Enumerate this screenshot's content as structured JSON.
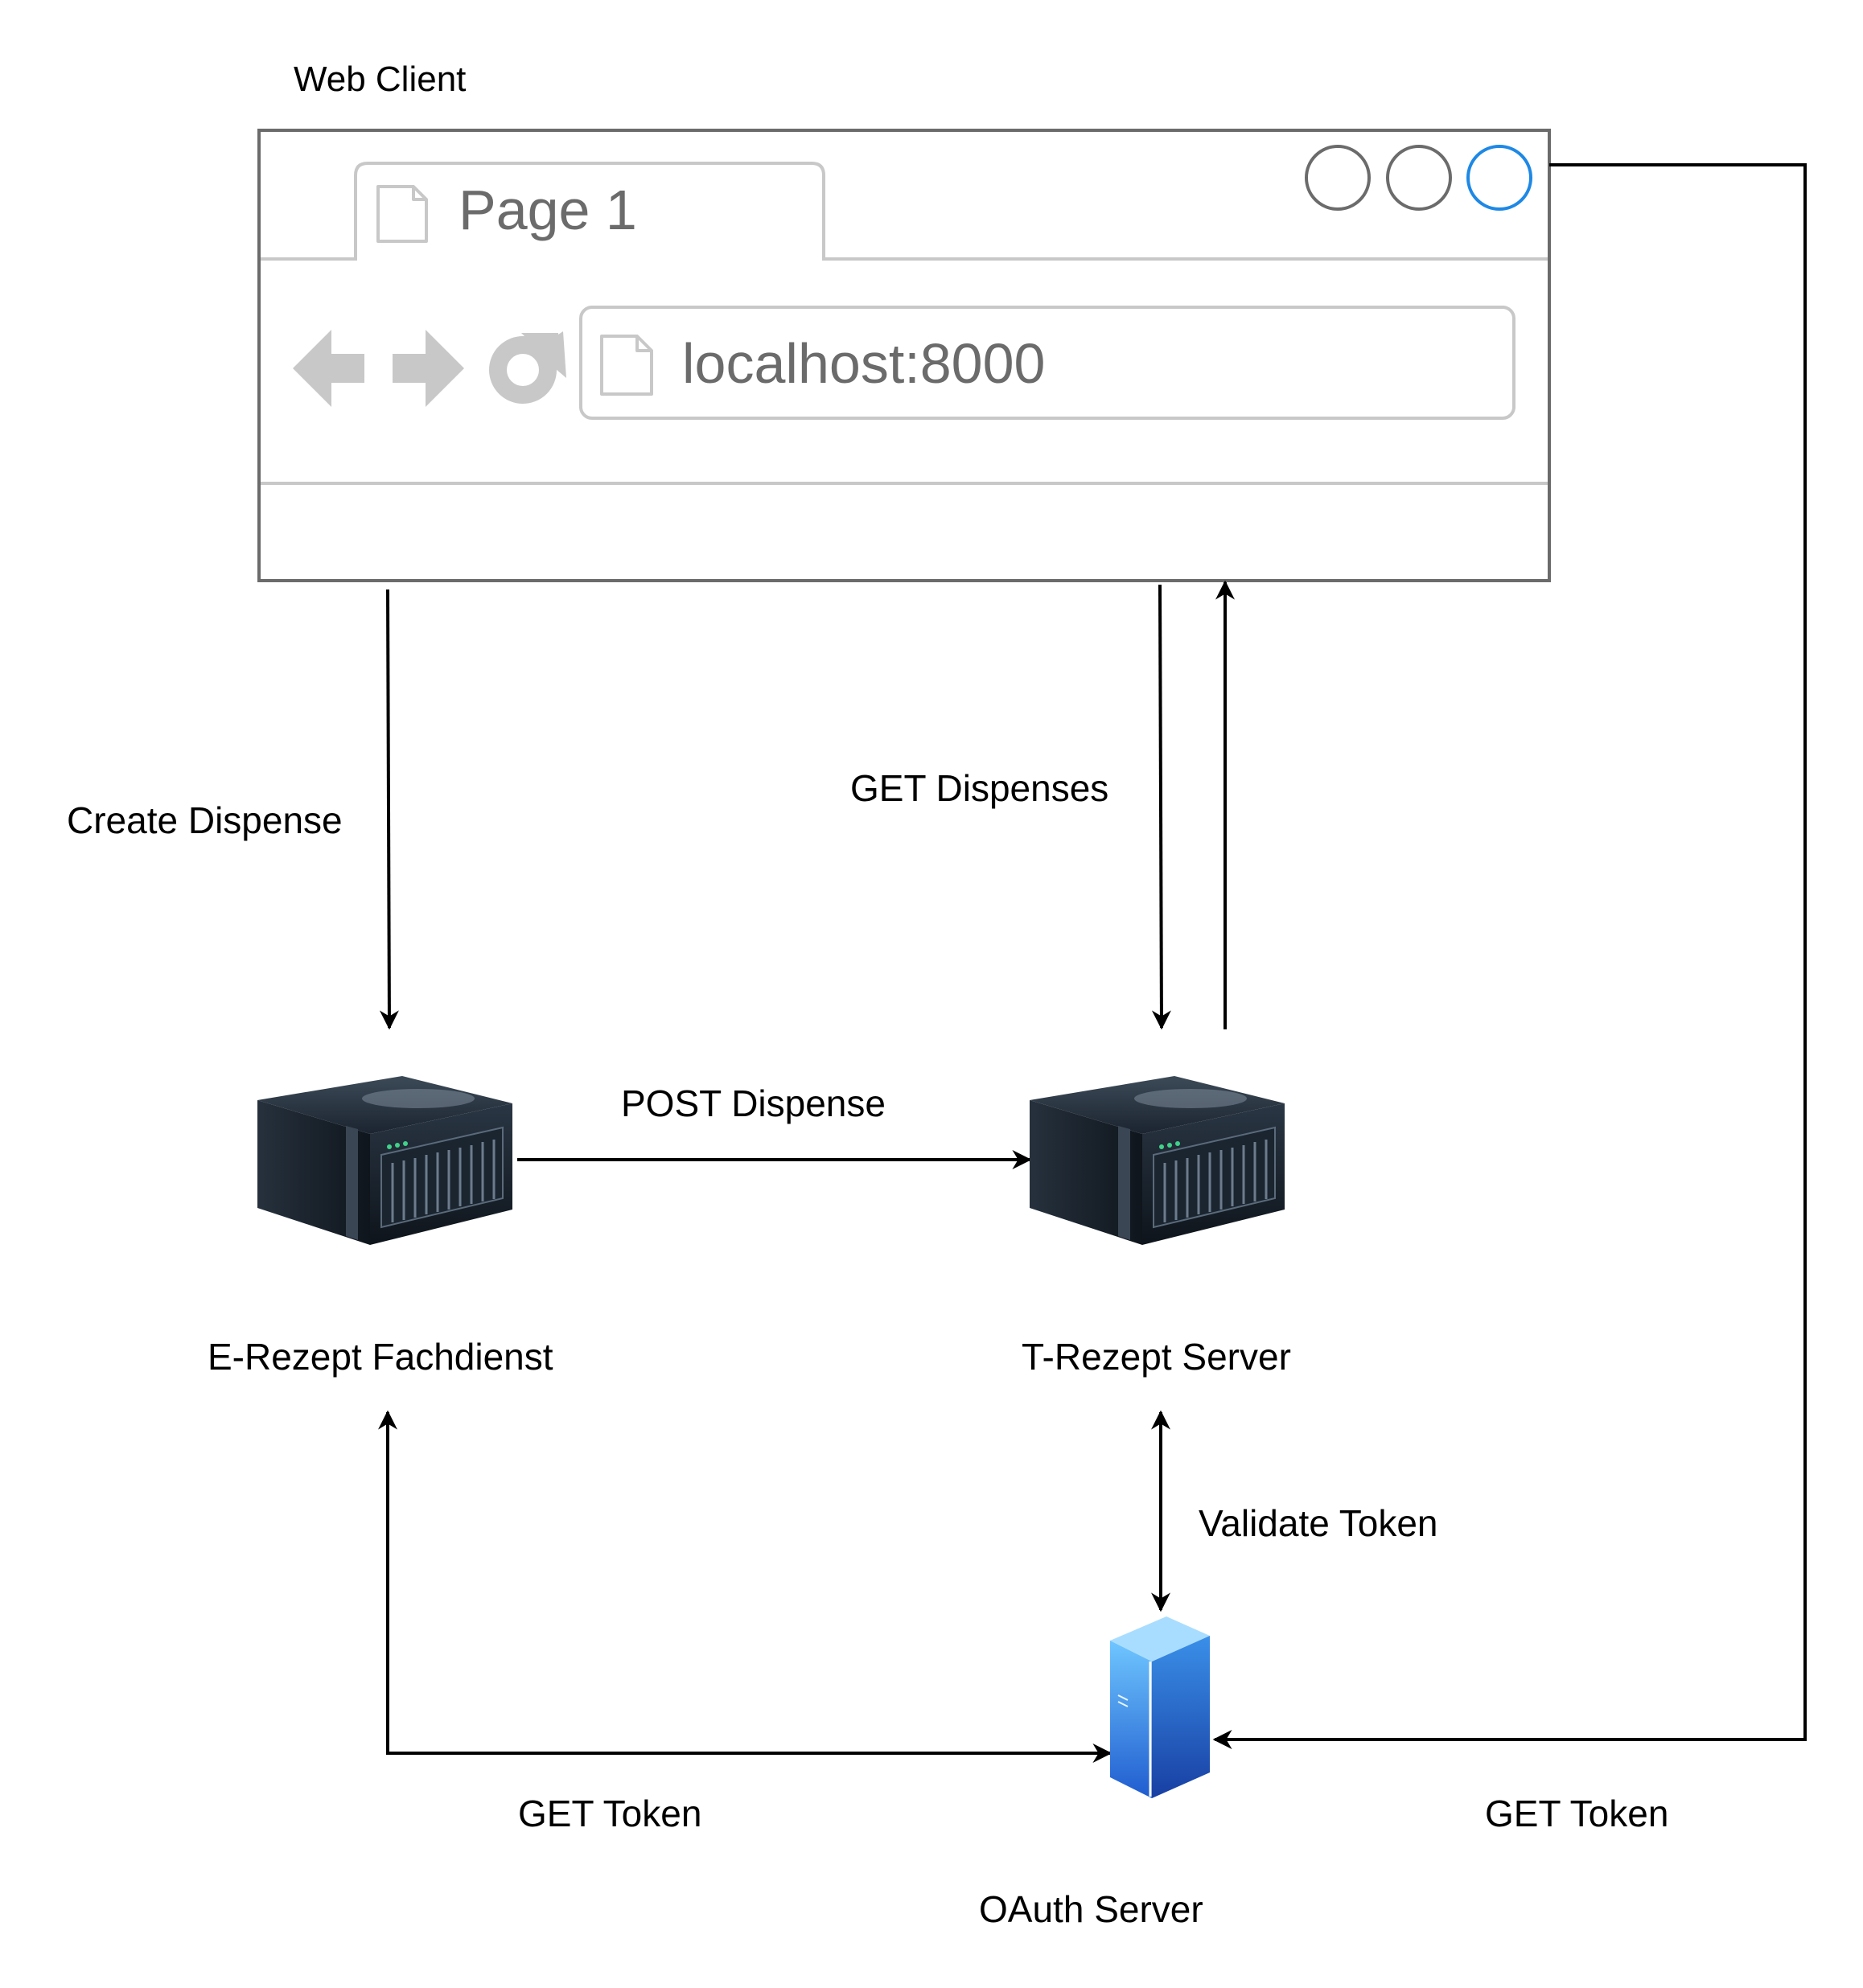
{
  "browser": {
    "window_label": "Web Client",
    "tab_label": "Page 1",
    "url": "localhost:8000"
  },
  "nodes": {
    "e_rezept": "E-Rezept Fachdienst",
    "t_rezept": "T-Rezept Server",
    "oauth": "OAuth Server"
  },
  "edges": {
    "create_dispense": "Create Dispense",
    "get_dispenses": "GET Dispenses",
    "post_dispense": "POST Dispense",
    "validate_token": "Validate Token",
    "get_token_left": "GET Token",
    "get_token_right": "GET Token"
  },
  "colors": {
    "line": "#000000",
    "browser_frame": "#6b6b6b",
    "browser_light": "#c8c8c8",
    "window_button_active": "#1e88e5"
  }
}
